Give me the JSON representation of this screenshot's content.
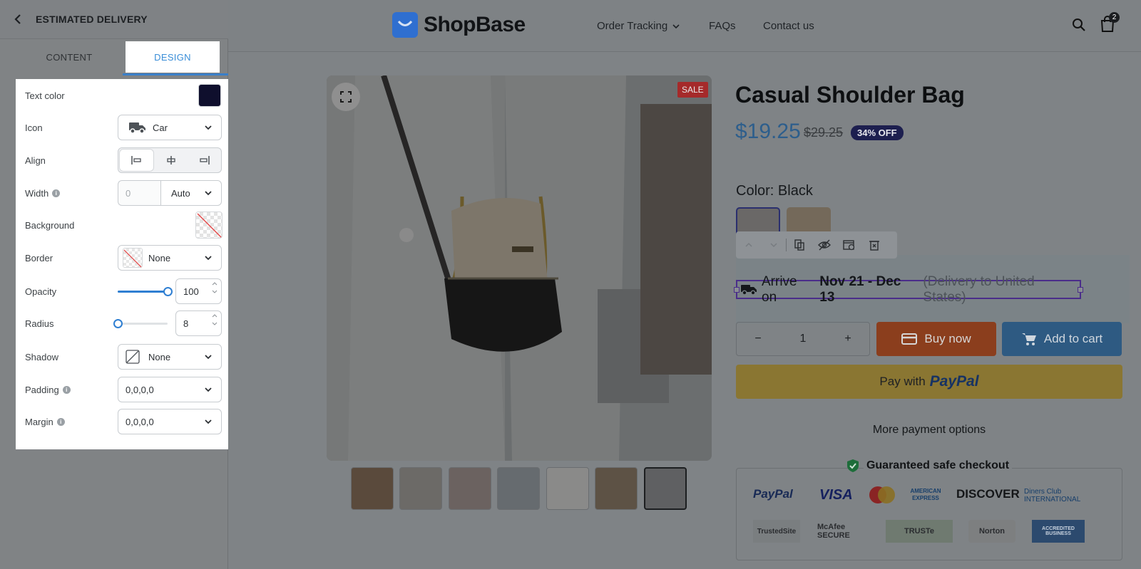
{
  "panel": {
    "title": "ESTIMATED DELIVERY",
    "tabs": [
      {
        "label": "CONTENT"
      },
      {
        "label": "DESIGN"
      }
    ],
    "active_tab": "DESIGN",
    "rows": {
      "text_color": {
        "label": "Text color",
        "value": "#0f0f2d"
      },
      "icon": {
        "label": "Icon",
        "value": "Car"
      },
      "align": {
        "label": "Align",
        "options": [
          "left",
          "center",
          "right"
        ],
        "selected": "left"
      },
      "width": {
        "label": "Width",
        "placeholder": "0",
        "unit": "Auto"
      },
      "background": {
        "label": "Background"
      },
      "border": {
        "label": "Border",
        "value": "None"
      },
      "opacity": {
        "label": "Opacity",
        "value": "100",
        "level": 1.0
      },
      "radius": {
        "label": "Radius",
        "value": "8",
        "level": 0.0
      },
      "shadow": {
        "label": "Shadow",
        "value": "None"
      },
      "padding": {
        "label": "Padding",
        "value": "0,0,0,0"
      },
      "margin": {
        "label": "Margin",
        "value": "0,0,0,0"
      }
    }
  },
  "store": {
    "logo_text": "ShopBase",
    "nav": [
      {
        "label": "Order Tracking"
      },
      {
        "label": "FAQs"
      },
      {
        "label": "Contact us"
      }
    ],
    "cart_count": "2"
  },
  "product": {
    "sale_badge": "SALE",
    "title": "Casual Shoulder Bag",
    "price": "$19.25",
    "compare_price": "$29.25",
    "discount": "34% OFF",
    "color_label": "Color: Black",
    "delivery": {
      "prefix": "Arrive on",
      "dates": "Nov 21 - Dec 13",
      "suffix": "(Delivery to United States)"
    },
    "quantity": "1",
    "qty_minus": "−",
    "qty_plus": "+",
    "buy_now": "Buy now",
    "add_to_cart": "Add to cart",
    "paypal_prefix": "Pay with",
    "paypal_word": "PayPal",
    "more_payment": "More payment options",
    "safe_checkout": "Guaranteed safe checkout",
    "payment_logos": [
      "PayPal",
      "VISA",
      "AMERICAN EXPRESS",
      "DISCOVER",
      "Diners Club INTERNATIONAL"
    ],
    "trust_seals": [
      "TrustedSite",
      "McAfee SECURE",
      "TRUSTe",
      "Norton",
      "ACCREDITED BUSINESS"
    ]
  },
  "colors": {
    "accent": "#3a8ed8",
    "buy_now": "#8b3e1d",
    "add_to_cart": "#2e5a82",
    "paypal": "#8a7632",
    "selection": "#4a2d8a"
  }
}
